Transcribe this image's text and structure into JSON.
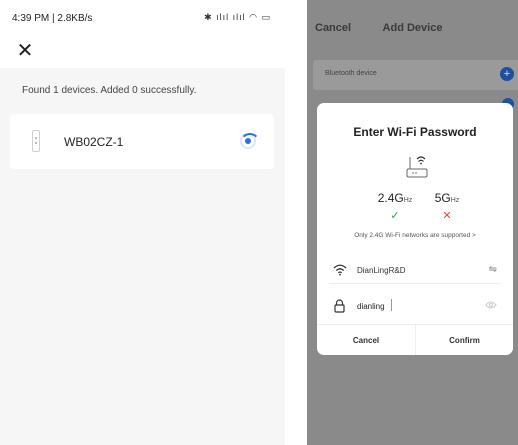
{
  "left": {
    "status_bar": {
      "time": "4:39 PM | 2.8KB/s",
      "icons": "✱ ılıl ılıl ◠ ▭"
    },
    "close_icon": "✕",
    "found_message": "Found 1 devices. Added 0 successfully.",
    "device": {
      "name": "WB02CZ-1"
    }
  },
  "right": {
    "header": {
      "cancel_label": "Cancel",
      "title": "Add Device"
    },
    "bluetooth_row": {
      "label": "Bluetooth device",
      "add_icon": "+"
    },
    "dialog": {
      "title": "Enter Wi-Fi Password",
      "band_24": {
        "value": "2.4G",
        "unit": "Hz",
        "mark": "✓"
      },
      "band_5": {
        "value": "5G",
        "unit": "Hz",
        "mark": "✕"
      },
      "note": "Only 2.4G Wi-Fi networks are supported >",
      "wifi_ssid": "DianLingR&D",
      "swap_icon": "⇋",
      "password_value": "dianling",
      "cancel_label": "Cancel",
      "confirm_label": "Confirm"
    }
  },
  "colors": {
    "accent_blue": "#2b72d9",
    "check_green": "#29a34a",
    "cross_red": "#e24545",
    "overlay_gray": "#8a8a8a"
  }
}
